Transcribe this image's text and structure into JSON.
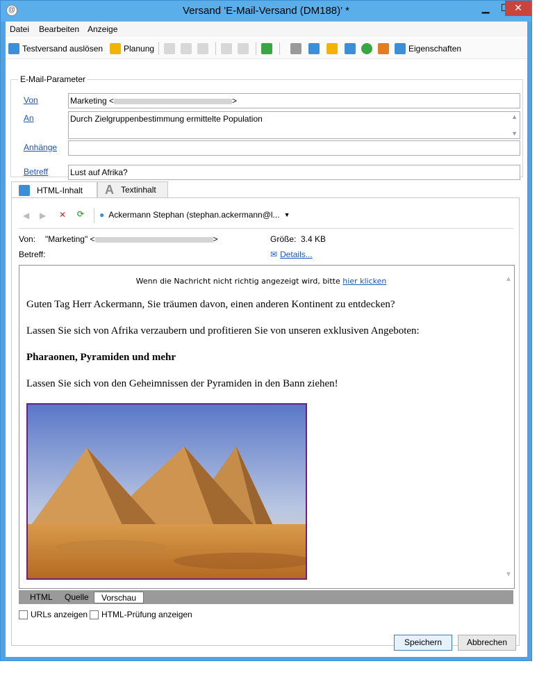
{
  "window": {
    "title": "Versand 'E-Mail-Versand (DM188)' *",
    "min": "▁",
    "max": "☐",
    "close": "✕"
  },
  "menu": [
    "Datei",
    "Bearbeiten",
    "Anzeige"
  ],
  "toolbar": {
    "test_send": "Testversand auslösen",
    "planning": "Planung",
    "properties": "Eigenschaften"
  },
  "params": {
    "legend": "E-Mail-Parameter",
    "from_label": "Von",
    "from_value": "Marketing <",
    "from_end": ">",
    "to_label": "An",
    "to_value": "Durch Zielgruppenbestimmung ermittelte Population",
    "attach_label": "Anhänge",
    "attach_value": "",
    "subject_label": "Betreff",
    "subject_value": "Lust auf Afrika?"
  },
  "tabs": {
    "html": "HTML-Inhalt",
    "text": "Textinhalt"
  },
  "preview_toolbar": {
    "recipient": "Ackermann Stephan (stephan.ackermann@l..."
  },
  "meta": {
    "from_label": "Von:",
    "from_value": "\"Marketing\" <",
    "from_end": ">",
    "size_label": "Größe:",
    "size_value": "3.4 KB",
    "subject_label": "Betreff:",
    "details": "Details..."
  },
  "email": {
    "header_text": "Wenn die Nachricht nicht richtig angezeigt wird, bitte",
    "header_link": "hier klicken",
    "p1": "Guten Tag Herr Ackermann, Sie träumen davon, einen anderen Kontinent zu entdecken?",
    "p2": "Lassen Sie sich von Afrika verzaubern und profitieren Sie von unseren exklusiven Angeboten:",
    "p3": "Pharaonen, Pyramiden und mehr",
    "p4": "Lassen Sie sich von den Geheimnissen der Pyramiden in den Bann ziehen!"
  },
  "bottom_tabs": [
    "HTML",
    "Quelle",
    "Vorschau"
  ],
  "checkboxes": {
    "urls": "URLs anzeigen",
    "html_check": "HTML-Prüfung anzeigen"
  },
  "buttons": {
    "save": "Speichern",
    "cancel": "Abbrechen"
  }
}
